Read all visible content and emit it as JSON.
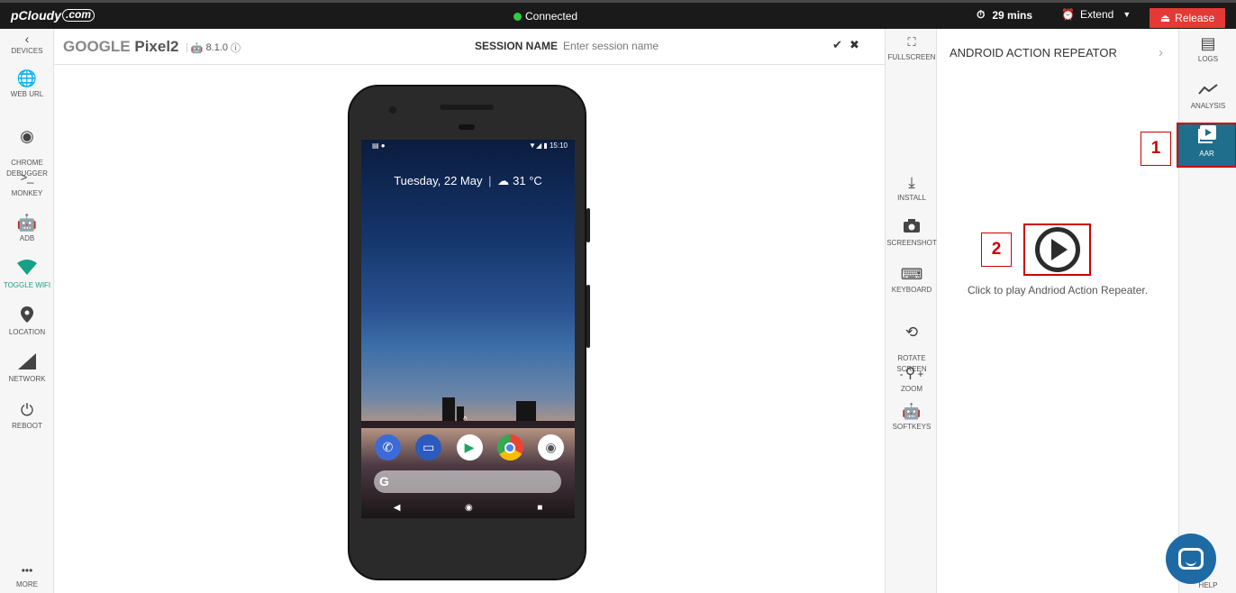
{
  "topbar": {
    "logo": "pCloudy",
    "logo_cloud": ".com",
    "status": "Connected",
    "timer": "29 mins",
    "extend_label": "Extend",
    "release_label": "Release"
  },
  "left_nav": [
    {
      "label": "DEVICES",
      "icon": "chevron-left-icon"
    },
    {
      "label": "WEB URL",
      "icon": "globe-icon"
    },
    {
      "label": "CHROME\nDEBUGGER",
      "icon": "chrome-icon"
    },
    {
      "label": "MONKEY",
      "icon": "terminal-icon"
    },
    {
      "label": "ADB",
      "icon": "android-icon"
    },
    {
      "label": "TOGGLE WIFI",
      "icon": "wifi-icon"
    },
    {
      "label": "LOCATION",
      "icon": "map-pin-icon"
    },
    {
      "label": "NETWORK",
      "icon": "signal-icon"
    },
    {
      "label": "REBOOT",
      "icon": "power-icon"
    },
    {
      "label": "MORE",
      "icon": "more-icon"
    }
  ],
  "device": {
    "brand": "GOOGLE",
    "model": "Pixel2",
    "os_version": "8.1.0",
    "session_label": "SESSION NAME",
    "session_placeholder": "Enter session name"
  },
  "phone_screen": {
    "time": "15:10",
    "date": "Tuesday, 22 May",
    "weather": "31 °C"
  },
  "mid_tools": [
    {
      "label": "FULLSCREEN",
      "icon": "fullscreen-icon"
    },
    {
      "label": "INSTALL",
      "icon": "download-icon"
    },
    {
      "label": "SCREENSHOT",
      "icon": "camera-icon"
    },
    {
      "label": "KEYBOARD",
      "icon": "keyboard-icon"
    },
    {
      "label": "ROTATE\nSCREEN",
      "icon": "rotate-icon"
    },
    {
      "label": "ZOOM",
      "icon": "zoom-icon"
    },
    {
      "label": "SOFTKEYS",
      "icon": "android-icon"
    }
  ],
  "panel": {
    "title": "ANDROID ACTION REPEATOR",
    "play_text": "Click to play Andriod Action Repeater."
  },
  "right_nav": [
    {
      "label": "LOGS",
      "icon": "logs-icon"
    },
    {
      "label": "ANALYSIS",
      "icon": "analysis-icon"
    },
    {
      "label": "AAR",
      "icon": "play-square-icon"
    },
    {
      "label": "HELP",
      "icon": "help-icon"
    }
  ],
  "annotations": {
    "marker_1": "1",
    "marker_2": "2"
  },
  "colors": {
    "accent": "#16a085",
    "release": "#e53935",
    "active_tab": "#1f6e8c",
    "annotation": "#cc0000",
    "connected": "#2ecc40"
  }
}
